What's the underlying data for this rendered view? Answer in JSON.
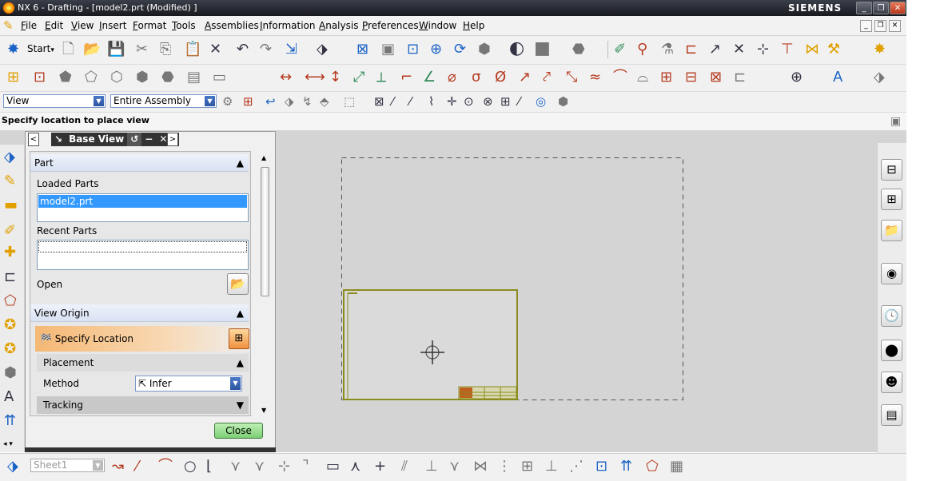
{
  "window": {
    "title": "NX 6 - Drafting - [model2.prt (Modified) ]",
    "brand": "SIEMENS",
    "controls": [
      "_",
      "❐",
      "✕"
    ]
  },
  "menu": {
    "items": [
      "File",
      "Edit",
      "View",
      "Insert",
      "Format",
      "Tools",
      "Assemblies",
      "Information",
      "Analysis",
      "Preferences",
      "Window",
      "Help"
    ],
    "mdi_controls": [
      "_",
      "❐",
      "✕"
    ]
  },
  "toolbar": {
    "start_label": "Start",
    "start_arrow": "▾",
    "filter_select": "View",
    "scope_select": "Entire Assembly"
  },
  "prompt": {
    "text": "Specify location to place view"
  },
  "dialog": {
    "title": "Base View",
    "nav_back": "<",
    "nav_forward": ">",
    "collapse_icon": "↘",
    "reset_icon": "↺",
    "minimize_icon": "−",
    "close_icon": "✕",
    "part_section": "Part",
    "loaded_parts_label": "Loaded Parts",
    "loaded_parts": [
      "model2.prt"
    ],
    "recent_parts_label": "Recent Parts",
    "open_label": "Open",
    "view_origin_section": "View Origin",
    "specify_location_label": "Specify Location",
    "placement_label": "Placement",
    "method_label": "Method",
    "method_value": "Infer",
    "tracking_label": "Tracking",
    "close_button": "Close"
  },
  "statusbar": {
    "sheet_select": "Sheet1"
  },
  "colors": {
    "accent": "#3399ff",
    "border_frame": "#8c8c1e",
    "close_button": "#7ccf74",
    "specify_location": "#f5b874"
  },
  "icons": {
    "collapse": "▲",
    "expand": "▼",
    "open_folder": "📂",
    "specify_location": "🏁",
    "method_infer": "⇱",
    "arrow_down": "▼"
  }
}
